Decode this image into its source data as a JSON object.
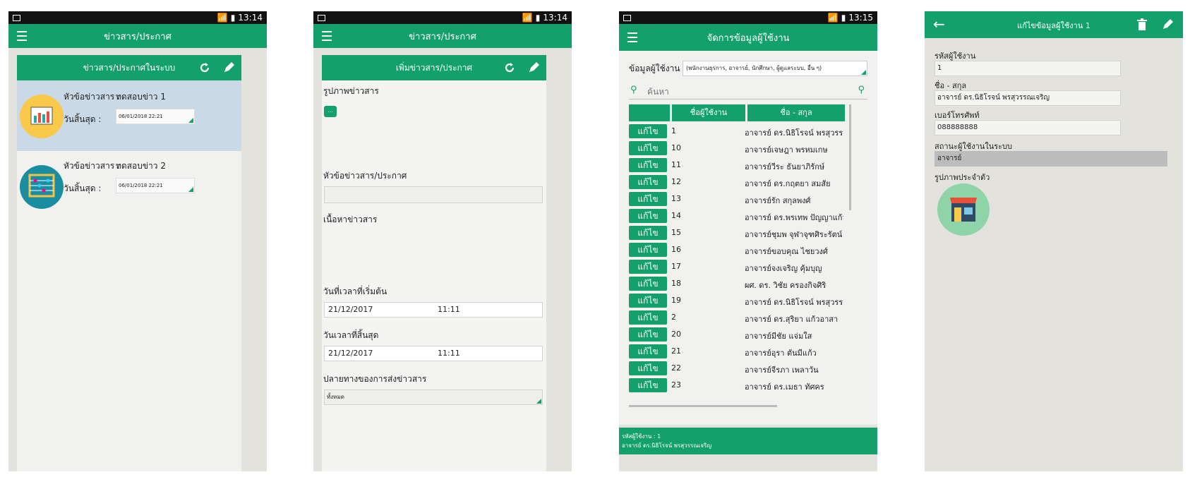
{
  "colors": {
    "primary": "#14a06b",
    "highlight": "#c9d9e6"
  },
  "status": {
    "time1": "13:14",
    "time2": "13:14",
    "time3": "13:15",
    "time4": ""
  },
  "screen1": {
    "appbar_title": "ข่าวสาร/ประกาศ",
    "header": "ข่าวสาร/ประกาศในระบบ",
    "items": [
      {
        "title_label": "หัวข้อข่าวสาร :",
        "title_value": "ทดสอบข่าว 1",
        "date_label": "วันสิ้นสุด :",
        "date_value": "06/01/2018 22:21",
        "icon": "dashboard-chart-icon"
      },
      {
        "title_label": "หัวข้อข่าวสาร :",
        "title_value": "ทดสอบข่าว 2",
        "date_label": "วันสิ้นสุด :",
        "date_value": "06/01/2018 22:21",
        "icon": "abacus-icon"
      }
    ]
  },
  "screen2": {
    "appbar_title": "ข่าวสาร/ประกาศ",
    "header": "เพิ่มข่าวสาร/ประกาศ",
    "image_label": "รูปภาพข่าวสาร",
    "image_btn": "...",
    "subject_label": "หัวข้อข่าวสาร/ประกาศ",
    "content_label": "เนื้อหาข่าวสาร",
    "start_label": "วันที่เวลาที่เริ่มต้น",
    "start_date": "21/12/2017",
    "start_time": "11:11",
    "end_label": "วันเวลาที่สิ้นสุด",
    "end_date": "21/12/2017",
    "end_time": "11:11",
    "target_label": "ปลายทางของการส่งข่าวสาร",
    "target_value": "ทั้งหมด"
  },
  "screen3": {
    "appbar_title": "จัดการข้อมูลผู้ใช้งาน",
    "filter_label": "ข้อมูลผู้ใช้งาน",
    "filter_value": "(พนักงานธุรการ, อาจารย์, นักศึกษา, ผู้ดูแลระบบ, อื่น ๆ)",
    "search_placeholder": "ค้นหา",
    "col_username": "ชื่อผู้ใช้งาน",
    "col_name": "ชื่อ - สกุล",
    "edit_label": "แก้ไข",
    "rows": [
      {
        "id": "1",
        "name": "อาจารย์ ดร.นิธิโรจน์ พรสุวรร..."
      },
      {
        "id": "10",
        "name": "อาจารย์เจษฎา พรหมเกษ"
      },
      {
        "id": "11",
        "name": "อาจารย์วีระ ธันยาภิรักษ์"
      },
      {
        "id": "12",
        "name": "อาจารย์ ดร.กฤตยา สมสัย"
      },
      {
        "id": "13",
        "name": "อาจารย์รัก สกุลพงศ์"
      },
      {
        "id": "14",
        "name": "อาจารย์ ดร.พรเทพ ปัญญาแก้ว"
      },
      {
        "id": "15",
        "name": "อาจารย์ชุมพ จุฬาจุฑศิระรัตน์"
      },
      {
        "id": "16",
        "name": "อาจารย์ขอบคุณ ไชยวงศ์"
      },
      {
        "id": "17",
        "name": "อาจารย์จงเจริญ คุ้มบุญ"
      },
      {
        "id": "18",
        "name": "ผศ. ดร. วิชัย ครองกิจศิริ"
      },
      {
        "id": "19",
        "name": "อาจารย์ ดร.นิธิโรจน์ พรสุวรร..."
      },
      {
        "id": "2",
        "name": "อาจารย์ ดร.สุริยา แก้วอาสา"
      },
      {
        "id": "20",
        "name": "อาจารย์มีชัย แจ่มใส"
      },
      {
        "id": "21",
        "name": "อาจารย์อุรา ตันมีแก้ว"
      },
      {
        "id": "22",
        "name": "อาจารย์จีรภา เพลาวัน"
      },
      {
        "id": "23",
        "name": "อาจารย์ ดร.เมธา ทัศคร"
      }
    ],
    "footer_line1": "รหัสผู้ใช้งาน : 1",
    "footer_line2": "อาจารย์ ดร.นิธิโรจน์ พรสุวรรณเจริญ"
  },
  "screen4": {
    "appbar_title": "แก้ไขข้อมูลผู้ใช้งาน 1",
    "id_label": "รหัสผู้ใช้งาน",
    "id_value": "1",
    "name_label": "ชื่อ - สกุล",
    "name_value": "อาจารย์ ดร.นิธิโรจน์ พรสุวรรณเจริญ",
    "phone_label": "เบอร์โทรศัพท์",
    "phone_value": "088888888",
    "role_label": "สถานะผู้ใช้งานในระบบ",
    "role_value": "อาจารย์",
    "photo_label": "รูปภาพประจำตัว"
  }
}
